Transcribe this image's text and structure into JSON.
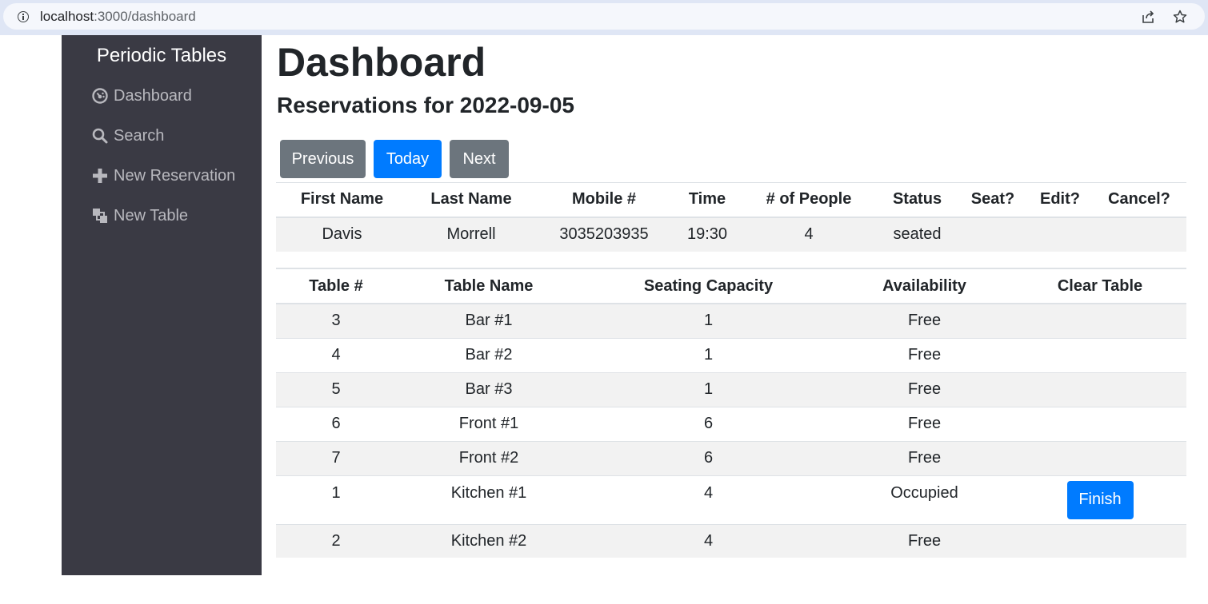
{
  "browser": {
    "url_host": "localhost",
    "url_path": ":3000/dashboard"
  },
  "sidebar": {
    "brand": "Periodic Tables",
    "items": [
      {
        "label": "Dashboard",
        "icon": "dashboard-icon"
      },
      {
        "label": "Search",
        "icon": "search-icon"
      },
      {
        "label": "New Reservation",
        "icon": "plus-icon"
      },
      {
        "label": "New Table",
        "icon": "table-icon"
      }
    ]
  },
  "main": {
    "title": "Dashboard",
    "subtitle": "Reservations for 2022-09-05",
    "buttons": {
      "previous": "Previous",
      "today": "Today",
      "next": "Next"
    }
  },
  "reservations": {
    "headers": [
      "First Name",
      "Last Name",
      "Mobile #",
      "Time",
      "# of People",
      "Status",
      "Seat?",
      "Edit?",
      "Cancel?"
    ],
    "rows": [
      {
        "first_name": "Davis",
        "last_name": "Morrell",
        "mobile": "3035203935",
        "time": "19:30",
        "people": "4",
        "status": "seated"
      }
    ]
  },
  "tables": {
    "headers": [
      "Table #",
      "Table Name",
      "Seating Capacity",
      "Availability",
      "Clear Table"
    ],
    "finish_label": "Finish",
    "rows": [
      {
        "id": "3",
        "name": "Bar #1",
        "capacity": "1",
        "availability": "Free"
      },
      {
        "id": "4",
        "name": "Bar #2",
        "capacity": "1",
        "availability": "Free"
      },
      {
        "id": "5",
        "name": "Bar #3",
        "capacity": "1",
        "availability": "Free"
      },
      {
        "id": "6",
        "name": "Front #1",
        "capacity": "6",
        "availability": "Free"
      },
      {
        "id": "7",
        "name": "Front #2",
        "capacity": "6",
        "availability": "Free"
      },
      {
        "id": "1",
        "name": "Kitchen #1",
        "capacity": "4",
        "availability": "Occupied"
      },
      {
        "id": "2",
        "name": "Kitchen #2",
        "capacity": "4",
        "availability": "Free"
      }
    ]
  },
  "colors": {
    "sidebar_bg": "#3a3a44",
    "primary": "#007bff",
    "secondary": "#6c757d"
  }
}
